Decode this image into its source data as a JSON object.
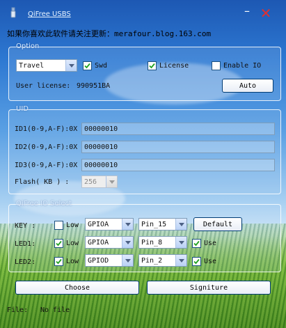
{
  "window": {
    "title": "QiFree USBS",
    "promo": "如果你喜欢此软件请关注更新：merafour.blog.163.com"
  },
  "colors": {
    "accent": "#003c74",
    "close": "#e03030",
    "sky": "#2d78d2",
    "grass": "#6fb03a"
  },
  "option": {
    "legend": "Option",
    "mode_value": "Travel",
    "swd_label": "Swd",
    "swd_checked": true,
    "license_label": "License",
    "license_checked": true,
    "enable_io_label": "Enable IO",
    "enable_io_checked": false,
    "user_license_label": "User license:",
    "user_license_value": "990951BA",
    "auto_button": "Auto"
  },
  "uid": {
    "legend": "UID",
    "rows": [
      {
        "label": "ID1(0-9,A-F):0X",
        "value": "00000010"
      },
      {
        "label": "ID2(0-9,A-F):0X",
        "value": "00000010"
      },
      {
        "label": "ID3(0-9,A-F):0X",
        "value": "00000010"
      }
    ],
    "flash_label": "Flash( KB ) :",
    "flash_value": "256"
  },
  "io": {
    "legend": "QiFree IO Select",
    "default_button": "Default",
    "rows": [
      {
        "label": "KEY :",
        "low_label": "Low",
        "low_checked": false,
        "gpio": "GPIOA",
        "pin": "Pin_15"
      },
      {
        "label": "LED1:",
        "low_label": "Low",
        "low_checked": true,
        "gpio": "GPIOA",
        "pin": "Pin_8",
        "use_label": "Use",
        "use_checked": true
      },
      {
        "label": "LED2:",
        "low_label": "Low",
        "low_checked": true,
        "gpio": "GPIOD",
        "pin": "Pin_2",
        "use_label": "Use",
        "use_checked": true
      }
    ]
  },
  "actions": {
    "choose_button": "Choose",
    "signiture_button": "Signiture"
  },
  "file": {
    "label": "File:",
    "value": "No file"
  }
}
